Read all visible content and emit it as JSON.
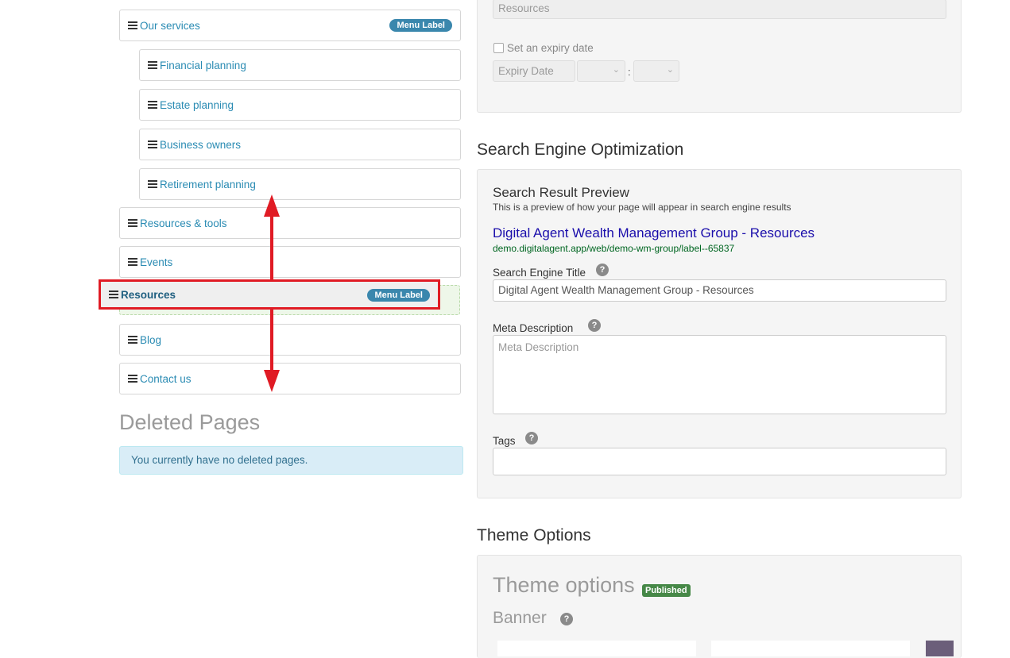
{
  "page_tree": {
    "items": [
      {
        "label": "Our services",
        "badge": "Menu Label"
      },
      {
        "label": "Financial planning"
      },
      {
        "label": "Estate planning"
      },
      {
        "label": "Business owners"
      },
      {
        "label": "Retirement planning"
      },
      {
        "label": "Resources & tools"
      },
      {
        "label": "Events"
      },
      {
        "label": "Resources",
        "badge": "Menu Label"
      },
      {
        "label": "Blog"
      },
      {
        "label": "Contact us"
      }
    ]
  },
  "deleted_pages": {
    "title": "Deleted Pages",
    "message": "You currently have no deleted pages."
  },
  "publish": {
    "resources_field_value": "Resources",
    "expiry_checkbox_label": "Set an expiry date",
    "expiry_date_placeholder": "Expiry Date",
    "time_separator": ":"
  },
  "seo": {
    "section_title": "Search Engine Optimization",
    "preview_title": "Search Result Preview",
    "preview_subtitle": "This is a preview of how your page will appear in search engine results",
    "preview_link_title": "Digital Agent Wealth Management Group - Resources",
    "preview_url": "demo.digitalagent.app/web/demo-wm-group/label--65837",
    "title_label": "Search Engine Title",
    "title_value": "Digital Agent Wealth Management Group - Resources",
    "meta_label": "Meta Description",
    "meta_placeholder": "Meta Description",
    "tags_label": "Tags",
    "help_glyph": "?"
  },
  "theme": {
    "section_title": "Theme Options",
    "panel_title": "Theme options",
    "status_badge": "Published",
    "banner_label": "Banner"
  },
  "colors": {
    "link": "#2a8bb3",
    "badge": "#3a87ad",
    "published": "#468847",
    "highlight": "#e01b24",
    "preview_title": "#1a0dab",
    "preview_url": "#006621"
  }
}
